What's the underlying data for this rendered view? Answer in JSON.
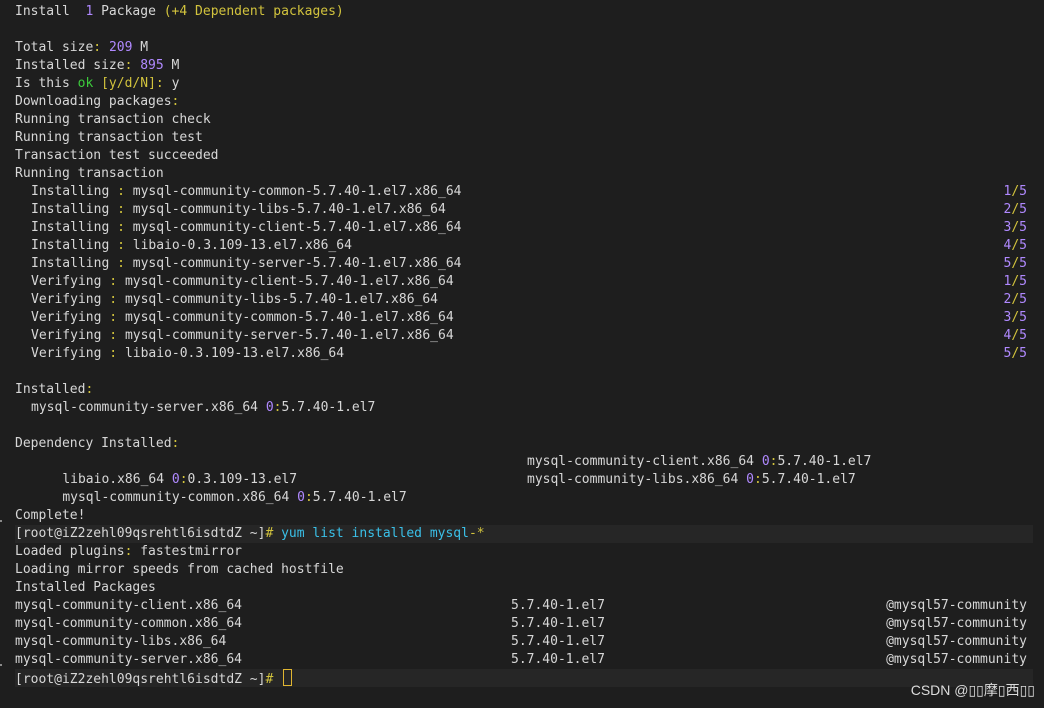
{
  "colors": {
    "background": "#1e1e1e",
    "text": "#d7d7d7",
    "purple": "#b089ff",
    "yellow": "#d2c33d",
    "green": "#3ccb3c",
    "cyan": "#3ac0e8",
    "cursor": "#e0b531"
  },
  "install_summary": {
    "word": "Install",
    "count": "1",
    "pkg_word": "Package",
    "deps": "(+4 Dependent packages)"
  },
  "sizes": {
    "total_label": "Total size",
    "total_value": "209",
    "total_unit": "M",
    "installed_label": "Installed size",
    "installed_value": "895",
    "installed_unit": "M"
  },
  "prompt_confirm": {
    "prefix": "Is this",
    "ok": "ok",
    "options": "[y/d/N]",
    "answer": "y"
  },
  "messages": {
    "downloading": "Downloading packages",
    "check": "Running transaction check",
    "test": "Running transaction test",
    "succeeded": "Transaction test succeeded",
    "running": "Running transaction"
  },
  "transaction_steps": [
    {
      "action": "Installing",
      "pkg": "mysql-community-common-5.7.40-1.el7.x86_64",
      "n": "1",
      "of": "5"
    },
    {
      "action": "Installing",
      "pkg": "mysql-community-libs-5.7.40-1.el7.x86_64",
      "n": "2",
      "of": "5"
    },
    {
      "action": "Installing",
      "pkg": "mysql-community-client-5.7.40-1.el7.x86_64",
      "n": "3",
      "of": "5"
    },
    {
      "action": "Installing",
      "pkg": "libaio-0.3.109-13.el7.x86_64",
      "n": "4",
      "of": "5"
    },
    {
      "action": "Installing",
      "pkg": "mysql-community-server-5.7.40-1.el7.x86_64",
      "n": "5",
      "of": "5"
    },
    {
      "action": "Verifying ",
      "pkg": "mysql-community-client-5.7.40-1.el7.x86_64",
      "n": "1",
      "of": "5"
    },
    {
      "action": "Verifying ",
      "pkg": "mysql-community-libs-5.7.40-1.el7.x86_64",
      "n": "2",
      "of": "5"
    },
    {
      "action": "Verifying ",
      "pkg": "mysql-community-common-5.7.40-1.el7.x86_64",
      "n": "3",
      "of": "5"
    },
    {
      "action": "Verifying ",
      "pkg": "mysql-community-server-5.7.40-1.el7.x86_64",
      "n": "4",
      "of": "5"
    },
    {
      "action": "Verifying ",
      "pkg": "libaio-0.3.109-13.el7.x86_64",
      "n": "5",
      "of": "5"
    }
  ],
  "installed": {
    "heading": "Installed",
    "items": [
      {
        "name": "mysql-community-server.x86_64",
        "epoch": "0",
        "version": "5.7.40-1.el7"
      }
    ]
  },
  "dependency_installed": {
    "heading": "Dependency Installed",
    "items": [
      {
        "name": "libaio.x86_64",
        "epoch": "0",
        "version": "0.3.109-13.el7"
      },
      {
        "name": "mysql-community-client.x86_64",
        "epoch": "0",
        "version": "5.7.40-1.el7"
      },
      {
        "name": "mysql-community-common.x86_64",
        "epoch": "0",
        "version": "5.7.40-1.el7"
      },
      {
        "name": "mysql-community-libs.x86_64",
        "epoch": "0",
        "version": "5.7.40-1.el7"
      }
    ]
  },
  "complete": "Complete!",
  "shell_prompt": "[root@iZ2zehl09qsrehtl6isdtdZ ~]",
  "prompt_symbol": "#",
  "command": {
    "cmd": "yum list installed mysql",
    "glob": "-*"
  },
  "yum_output": {
    "plugins_label": "Loaded plugins",
    "plugins_value": "fastestmirror",
    "mirror_line": "Loading mirror speeds from cached hostfile",
    "installed_packages": "Installed Packages"
  },
  "installed_packages": [
    {
      "name": "mysql-community-client.x86_64",
      "version": "5.7.40-1.el7",
      "repo": "@mysql57-community"
    },
    {
      "name": "mysql-community-common.x86_64",
      "version": "5.7.40-1.el7",
      "repo": "@mysql57-community"
    },
    {
      "name": "mysql-community-libs.x86_64",
      "version": "5.7.40-1.el7",
      "repo": "@mysql57-community"
    },
    {
      "name": "mysql-community-server.x86_64",
      "version": "5.7.40-1.el7",
      "repo": "@mysql57-community"
    }
  ],
  "watermark": "CSDN @▯▯摩▯西▯▯"
}
